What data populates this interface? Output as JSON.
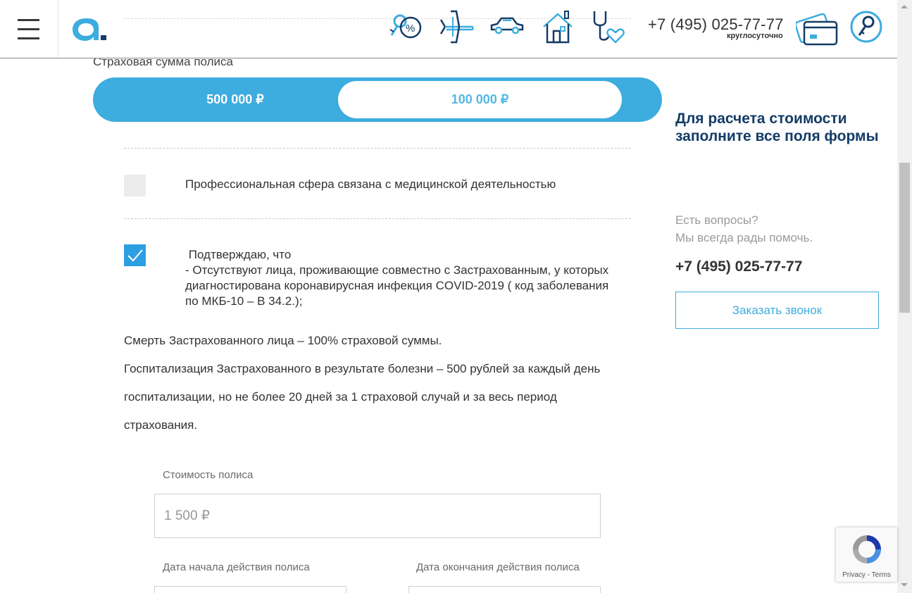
{
  "header": {
    "phone": "+7 (495) 025-77-77",
    "phone_note": "круглосуточно",
    "nav_icons": [
      "key-percent-icon",
      "airplane-icon",
      "car-icon",
      "house-icon",
      "stethoscope-heart-icon"
    ],
    "action_icons": [
      "cards-icon",
      "search-key-icon"
    ],
    "logo_text": "a."
  },
  "sum": {
    "label": "Страховая сумма полиса",
    "options": [
      "500 000 ₽",
      "100 000 ₽"
    ],
    "selected_index": 1
  },
  "checkboxes": [
    {
      "checked": false,
      "text": "Профессиональная сфера связана с медицинской деятельностью"
    },
    {
      "checked": true,
      "lines": [
        " Подтверждаю, что",
        "- Отсутствуют лица, проживающие совместно с Застрахованным, у которых",
        "диагностирована коронавирусная инфекция COVID-2019 ( код заболевания",
        "по МКБ-10 – В 34.2.);"
      ]
    }
  ],
  "info_lines": [
    "Смерть Застрахованного лица – 100% страховой суммы.",
    "Госпитализация Застрахованного в результате болезни – 500 рублей за каждый день",
    "госпитализации, но не более 20 дней за 1 страховой случай и за весь период",
    "страхования."
  ],
  "form": {
    "cost_label": "Стоимость полиса",
    "cost_value": "1 500 ₽",
    "start_label": "Дата начала действия полиса",
    "end_label": "Дата окончания действия полиса"
  },
  "sidebar": {
    "title": "Для расчета стоимости заполните все поля формы",
    "q1": "Есть вопросы?",
    "q2": "Мы всегда рады помочь.",
    "phone": "+7 (495) 025-77-77",
    "callback": "Заказать звонок"
  },
  "recaptcha": {
    "links": "Privacy - Terms"
  },
  "colors": {
    "accent": "#3dacde",
    "checkbox": "#2c9fe2",
    "title": "#143c66",
    "logo_blue": "#3dacde",
    "logo_dark": "#143c66"
  }
}
